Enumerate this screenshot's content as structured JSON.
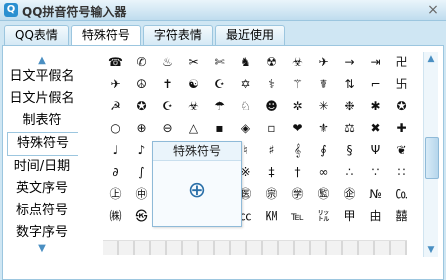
{
  "window": {
    "title": "QQ拼音符号输入器",
    "app_icon": "qq-pinyin-icon",
    "close_icon": "×"
  },
  "tabs": [
    {
      "label": "QQ表情"
    },
    {
      "label": "特殊符号"
    },
    {
      "label": "字符表情"
    },
    {
      "label": "最近使用"
    }
  ],
  "active_tab": "特殊符号",
  "sidebar": {
    "up_arrow": "▲",
    "down_arrow": "▼",
    "items": [
      {
        "label": "日文平假名"
      },
      {
        "label": "日文片假名"
      },
      {
        "label": "制表符"
      },
      {
        "label": "特殊符号"
      },
      {
        "label": "时间/日期"
      },
      {
        "label": "英文序号"
      },
      {
        "label": "标点符号"
      },
      {
        "label": "数字序号"
      }
    ],
    "active_item": "特殊符号"
  },
  "symbols": [
    [
      "☎",
      "✆",
      "♨",
      "✂",
      "✄",
      "♞",
      "☢",
      "☣",
      "✈",
      "→",
      "⇥",
      "卍"
    ],
    [
      "✈",
      "☮",
      "✝",
      "☯",
      "☪",
      "✡",
      "⚕",
      "⚚",
      "☤",
      "⇅",
      "⌐",
      "卐"
    ],
    [
      "☭",
      "✪",
      "☪",
      "☣",
      "☂",
      "♘",
      "☻",
      "✲",
      "✳",
      "❉",
      "✱",
      "✪"
    ],
    [
      "○",
      "⊕",
      "⊖",
      "△",
      "▪",
      "◈",
      "▫",
      "❤",
      "⚜",
      "⚖",
      "✖",
      "✚"
    ],
    [
      "♩",
      "♪",
      "♫",
      "♬",
      "♭",
      "♮",
      "♯",
      "𝄞",
      "∮",
      "§",
      "Ψ",
      "❦"
    ],
    [
      "∂",
      "∫",
      "∯",
      "…",
      "⁂",
      "※",
      "‡",
      "†",
      "∞",
      "∴",
      "∵",
      "∷"
    ],
    [
      "㊤",
      "㊥",
      "㊦",
      "㊧",
      "㊨",
      "㊩",
      "㊪",
      "㊫",
      "㊬",
      "㊭",
      "№",
      "㏇"
    ],
    [
      "㈱",
      "㉿",
      "㈲",
      "㍿",
      "㎞",
      "㏄",
      "㏎",
      "℡",
      "㍑",
      "甲",
      "由",
      "囍"
    ]
  ],
  "tooltip": {
    "title": "特殊符号",
    "symbol": "⊕"
  },
  "scrollbar": {
    "up": "▲",
    "down": "▼"
  }
}
